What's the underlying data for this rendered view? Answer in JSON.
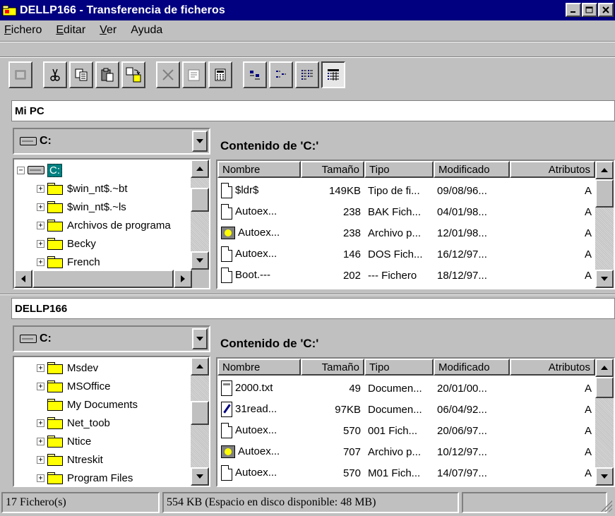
{
  "window": {
    "title": "DELLP166 - Transferencia de ficheros",
    "buttons": {
      "minimize": "_",
      "maximize": "□",
      "close": "×"
    }
  },
  "menu": {
    "items": [
      {
        "accel": "F",
        "rest": "ichero"
      },
      {
        "accel": "E",
        "rest": "ditar"
      },
      {
        "accel": "V",
        "rest": "er"
      },
      {
        "accel": "",
        "rest": "Ayuda"
      }
    ]
  },
  "toolbar": {
    "buttons": [
      "disconnect-icon",
      "cut-icon",
      "copy-icon",
      "paste-icon",
      "transfer-icon",
      "delete-icon",
      "properties-icon",
      "calculator-icon",
      "large-icons-icon",
      "small-icons-icon",
      "list-view-icon",
      "details-view-icon"
    ],
    "pressed": "details-view-icon"
  },
  "local": {
    "section_title": "Mi PC",
    "drive": "C:",
    "content_title": "Contenido de 'C:'",
    "tree": [
      {
        "label": "C:",
        "expander": "−",
        "type": "drive",
        "selected": true
      },
      {
        "label": "$win_nt$.~bt",
        "expander": "+",
        "type": "folder"
      },
      {
        "label": "$win_nt$.~ls",
        "expander": "+",
        "type": "folder"
      },
      {
        "label": "Archivos de programa",
        "expander": "+",
        "type": "folder"
      },
      {
        "label": "Becky",
        "expander": "+",
        "type": "folder"
      },
      {
        "label": "French",
        "expander": "+",
        "type": "folder"
      }
    ],
    "columns": [
      "Nombre",
      "Tamaño",
      "Tipo",
      "Modificado",
      "Atributos"
    ],
    "files": [
      {
        "icon": "doc",
        "name": "$ldr$",
        "size": "149KB",
        "type": "Tipo de fi...",
        "modified": "09/08/96...",
        "attr": "A"
      },
      {
        "icon": "doc",
        "name": "Autoex...",
        "size": "238",
        "type": "BAK Fich...",
        "modified": "04/01/98...",
        "attr": "A"
      },
      {
        "icon": "exe",
        "name": "Autoex...",
        "size": "238",
        "type": "Archivo p...",
        "modified": "12/01/98...",
        "attr": "A"
      },
      {
        "icon": "doc",
        "name": "Autoex...",
        "size": "146",
        "type": "DOS Fich...",
        "modified": "16/12/97...",
        "attr": "A"
      },
      {
        "icon": "doc",
        "name": "Boot.---",
        "size": "202",
        "type": "--- Fichero",
        "modified": "18/12/97...",
        "attr": "A"
      }
    ]
  },
  "remote": {
    "section_title": "DELLP166",
    "drive": "C:",
    "content_title": "Contenido de 'C:'",
    "tree": [
      {
        "label": "Msdev",
        "expander": "+",
        "type": "folder"
      },
      {
        "label": "MSOffice",
        "expander": "+",
        "type": "folder"
      },
      {
        "label": "My Documents",
        "expander": "",
        "type": "folder"
      },
      {
        "label": "Net_toob",
        "expander": "+",
        "type": "folder"
      },
      {
        "label": "Ntice",
        "expander": "+",
        "type": "folder"
      },
      {
        "label": "Ntreskit",
        "expander": "+",
        "type": "folder"
      },
      {
        "label": "Program Files",
        "expander": "+",
        "type": "folder"
      }
    ],
    "columns": [
      "Nombre",
      "Tamaño",
      "Tipo",
      "Modificado",
      "Atributos"
    ],
    "files": [
      {
        "icon": "txt",
        "name": "2000.txt",
        "size": "49",
        "type": "Documen...",
        "modified": "20/01/00...",
        "attr": "A"
      },
      {
        "icon": "pen",
        "name": "31read...",
        "size": "97KB",
        "type": "Documen...",
        "modified": "06/04/92...",
        "attr": "A"
      },
      {
        "icon": "doc",
        "name": "Autoex...",
        "size": "570",
        "type": "001 Fich...",
        "modified": "20/06/97...",
        "attr": "A"
      },
      {
        "icon": "exe",
        "name": "Autoex...",
        "size": "707",
        "type": "Archivo p...",
        "modified": "10/12/97...",
        "attr": "A"
      },
      {
        "icon": "doc",
        "name": "Autoex...",
        "size": "570",
        "type": "M01 Fich...",
        "modified": "14/07/97...",
        "attr": "A"
      }
    ]
  },
  "status": {
    "files": "17 Fichero(s)",
    "space": "554 KB (Espacio en disco disponible: 48 MB)",
    "extra": ""
  }
}
